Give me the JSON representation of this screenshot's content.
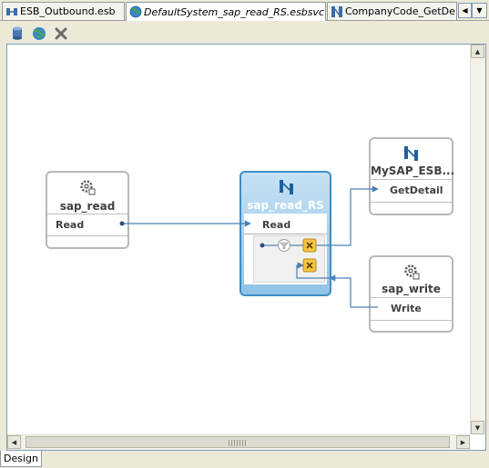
{
  "tabs": [
    {
      "label": "ESB_Outbound.esb",
      "icon": "esb-diagram-icon",
      "active": false
    },
    {
      "label": "DefaultSystem_sap_read_RS.esbsvc",
      "icon": "globe-service-icon",
      "active": true
    },
    {
      "label": "CompanyCode_GetDe",
      "icon": "routing-service-icon",
      "active": false
    }
  ],
  "nav": {
    "left": "◀",
    "right": "▶",
    "menu": "▼"
  },
  "toolbar": {
    "items": [
      "database-icon",
      "globe-icon",
      "delete-x-icon"
    ]
  },
  "nodes": {
    "sap_read": {
      "title": "sap_read",
      "operation": "Read",
      "icon": "gear-adapter-icon"
    },
    "router": {
      "title": "sap_read_RS",
      "operation": "Read",
      "icon": "routing-service-icon",
      "filter_icon": "filter-icon",
      "transform_icon_label": "X"
    },
    "mysap": {
      "title": "MySAP_ESB...",
      "operation": "GetDetail",
      "icon": "routing-service-icon"
    },
    "sap_write": {
      "title": "sap_write",
      "operation": "Write",
      "icon": "gear-adapter-icon"
    }
  },
  "colors": {
    "accent": "#3d8ec6",
    "line": "#4b7fb3",
    "transform": "#f5c542"
  },
  "bottom_tab": {
    "label": "Design"
  }
}
